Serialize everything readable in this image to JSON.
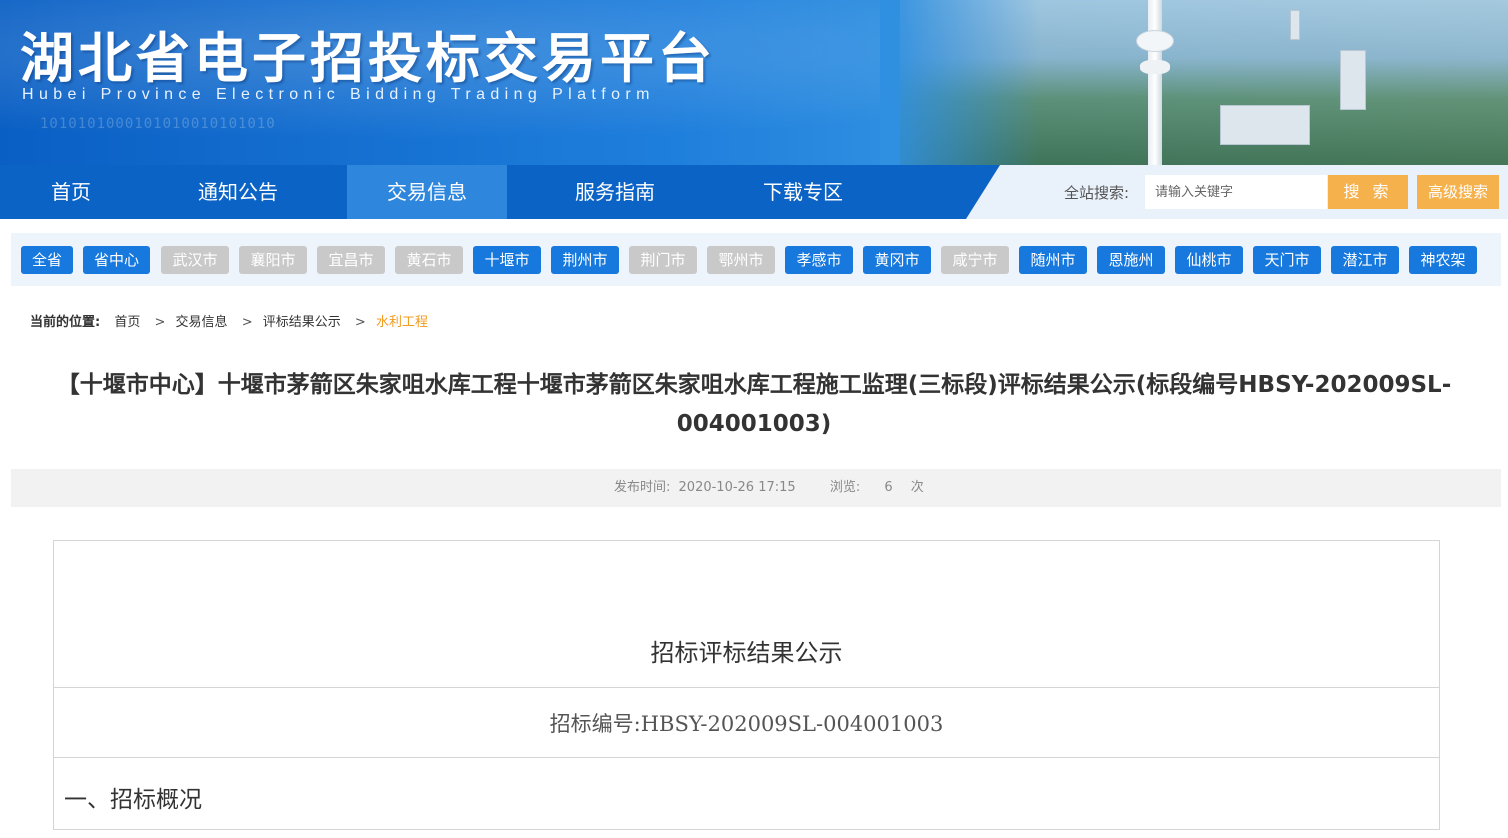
{
  "header": {
    "title": "湖北省电子招投标交易平台",
    "subtitle": "Hubei Province Electronic Bidding Trading Platform",
    "decor_binary": "1010101000101010010101010"
  },
  "nav": {
    "items": [
      {
        "label": "首页",
        "active": false
      },
      {
        "label": "通知公告",
        "active": false
      },
      {
        "label": "交易信息",
        "active": true
      },
      {
        "label": "服务指南",
        "active": false
      },
      {
        "label": "下载专区",
        "active": false
      }
    ],
    "search_label": "全站搜索:",
    "search_placeholder": "请输入关键字",
    "search_button": "搜 索",
    "advanced_button": "高级搜索"
  },
  "regions": [
    {
      "label": "全省",
      "enabled": true
    },
    {
      "label": "省中心",
      "enabled": true
    },
    {
      "label": "武汉市",
      "enabled": false
    },
    {
      "label": "襄阳市",
      "enabled": false
    },
    {
      "label": "宜昌市",
      "enabled": false
    },
    {
      "label": "黄石市",
      "enabled": false
    },
    {
      "label": "十堰市",
      "enabled": true
    },
    {
      "label": "荆州市",
      "enabled": true
    },
    {
      "label": "荆门市",
      "enabled": false
    },
    {
      "label": "鄂州市",
      "enabled": false
    },
    {
      "label": "孝感市",
      "enabled": true
    },
    {
      "label": "黄冈市",
      "enabled": true
    },
    {
      "label": "咸宁市",
      "enabled": false
    },
    {
      "label": "随州市",
      "enabled": true
    },
    {
      "label": "恩施州",
      "enabled": true
    },
    {
      "label": "仙桃市",
      "enabled": true
    },
    {
      "label": "天门市",
      "enabled": true
    },
    {
      "label": "潜江市",
      "enabled": true
    },
    {
      "label": "神农架",
      "enabled": true
    }
  ],
  "breadcrumb": {
    "label": "当前的位置:",
    "items": [
      "首页",
      "交易信息",
      "评标结果公示",
      "水利工程"
    ]
  },
  "article": {
    "title": "【十堰市中心】十堰市茅箭区朱家咀水库工程十堰市茅箭区朱家咀水库工程施工监理(三标段)评标结果公示(标段编号HBSY-202009SL-004001003)",
    "publish_label": "发布时间:",
    "publish_time": "2020-10-26 17:15",
    "views_label": "浏览:",
    "views": "6",
    "views_unit": "次"
  },
  "document": {
    "heading": "招标评标结果公示",
    "code_line": "招标编号:HBSY-202009SL-004001003",
    "section1": "一、招标概况"
  },
  "colors": {
    "nav_blue": "#0b63c6",
    "nav_active": "#2e86dd",
    "region_on": "#1778dd",
    "region_off": "#c9c9c9",
    "search_button": "#f5b14c",
    "breadcrumb_current": "#f19c21"
  }
}
